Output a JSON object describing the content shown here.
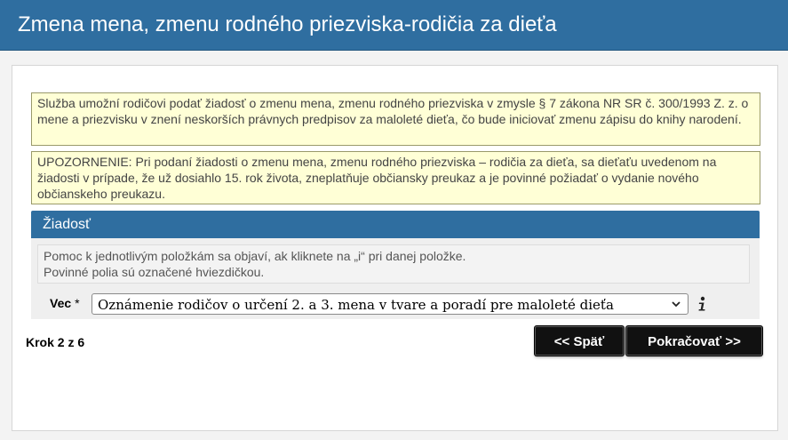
{
  "page": {
    "title": "Zmena mena, zmenu rodného priezviska-rodičia za dieťa"
  },
  "notices": [
    {
      "text": "Služba umožní rodičovi podať žiadosť o zmenu mena, zmenu rodného priezviska v zmysle § 7 zákona NR SR č. 300/1993 Z. z. o mene a priezvisku v znení neskorších právnych predpisov za maloleté dieťa, čo bude iniciovať zmenu zápisu do knihy narodení."
    },
    {
      "text": "UPOZORNENIE: Pri podaní žiadosti o zmenu mena, zmenu rodného priezviska – rodičia za dieťa, sa dieťaťu uvedenom na žiadosti v prípade, že už dosiahlo 15. rok života, zneplatňuje občiansky preukaz a je povinné požiadať o vydanie nového občianskeho preukazu."
    }
  ],
  "form": {
    "section_title": "Žiadosť",
    "help_lines": [
      "Pomoc k jednotlivým položkám sa objaví, ak kliknete na „i“ pri danej položke.",
      "Povinné polia sú označené hviezdičkou."
    ],
    "subject_label": "Vec",
    "required_mark": "*",
    "subject_value": "Oznámenie rodičov o určení 2. a 3. mena v tvare a poradí pre maloleté dieťa",
    "info_icon": "info-icon"
  },
  "footer": {
    "step_text": "Krok 2 z 6",
    "back_label": "<< Späť",
    "next_label": "Pokračovať >>"
  },
  "colors": {
    "header_bg": "#2f6ea0",
    "notice_bg": "#ffffd6",
    "button_bg": "#111111"
  }
}
